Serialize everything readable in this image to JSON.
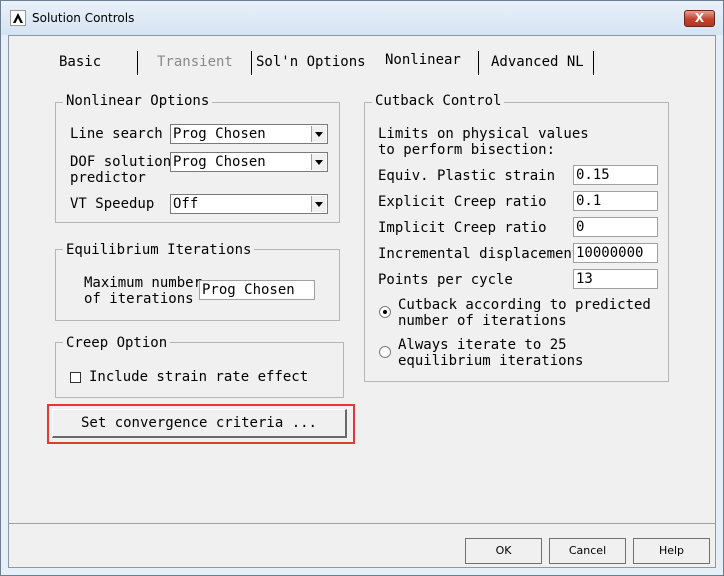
{
  "window": {
    "title": "Solution Controls",
    "close_label": "X"
  },
  "tabs": [
    "Basic",
    "Transient",
    "Sol'n Options",
    "Nonlinear",
    "Advanced NL"
  ],
  "nonlinear_options": {
    "title": "Nonlinear Options",
    "line_search_label": "Line search",
    "line_search_value": "Prog Chosen",
    "dof_label_1": "DOF solution",
    "dof_label_2": "predictor",
    "dof_value": "Prog Chosen",
    "vt_label": "VT Speedup",
    "vt_value": "Off"
  },
  "equilibrium": {
    "title": "Equilibrium Iterations",
    "max_label_1": "Maximum number",
    "max_label_2": "of iterations",
    "max_value": "Prog Chosen"
  },
  "creep": {
    "title": "Creep Option",
    "include_label": "Include strain rate effect"
  },
  "set_convergence_label": "Set convergence criteria ...",
  "cutback": {
    "title": "Cutback Control",
    "desc_1": "Limits on physical values",
    "desc_2": "to perform bisection:",
    "rows": [
      {
        "label": "Equiv. Plastic strain",
        "value": "0.15"
      },
      {
        "label": "Explicit Creep ratio",
        "value": "0.1"
      },
      {
        "label": "Implicit Creep ratio",
        "value": "0"
      },
      {
        "label": "Incremental displacement",
        "value": "10000000"
      },
      {
        "label": "Points per cycle",
        "value": "13"
      }
    ],
    "radio1_label_1": "Cutback according to predicted",
    "radio1_label_2": "number of iterations",
    "radio2_label_1": "Always iterate to 25",
    "radio2_label_2": "equilibrium iterations"
  },
  "buttons": {
    "ok": "OK",
    "cancel": "Cancel",
    "help": "Help"
  }
}
